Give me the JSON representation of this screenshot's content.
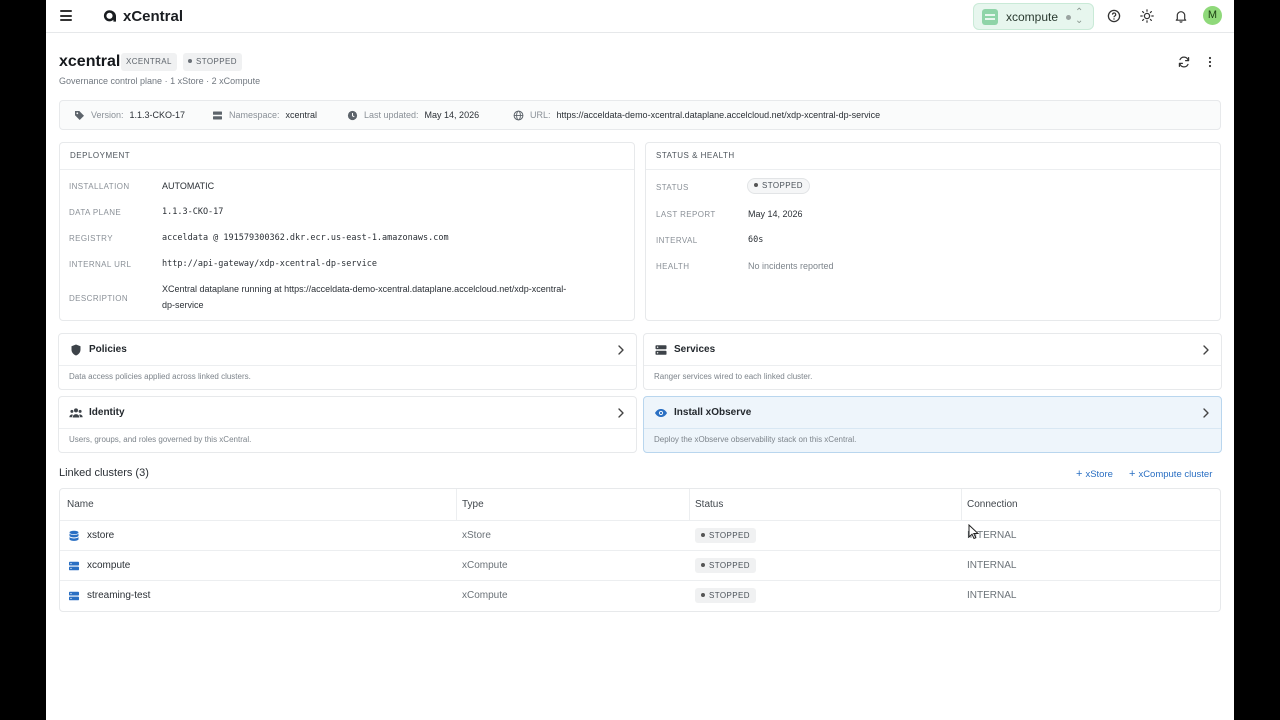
{
  "topbar": {
    "app_title": "xCentral",
    "cluster_selector": "xcompute",
    "avatar_initial": "M"
  },
  "page": {
    "title": "xcentral",
    "type_tag": "XCENTRAL",
    "status_tag": "STOPPED",
    "subtitle": "Governance control plane · 1 xStore · 2 xCompute"
  },
  "info": {
    "version_label": "Version:",
    "version": "1.1.3-CKO-17",
    "namespace_label": "Namespace:",
    "namespace": "xcentral",
    "updated_label": "Last updated:",
    "updated": "May 14, 2026",
    "url_label": "URL:",
    "url": "https://acceldata-demo-xcentral.dataplane.accelcloud.net/xdp-xcentral-dp-service"
  },
  "deployment": {
    "heading": "DEPLOYMENT",
    "installation_label": "INSTALLATION",
    "installation": "AUTOMATIC",
    "dataplane_label": "DATA PLANE",
    "dataplane": "1.1.3-CKO-17",
    "registry_label": "REGISTRY",
    "registry": "acceldata @ 191579300362.dkr.ecr.us-east-1.amazonaws.com",
    "internal_url_label": "INTERNAL URL",
    "internal_url": "http://api-gateway/xdp-xcentral-dp-service",
    "description_label": "DESCRIPTION",
    "description_line1": "XCentral dataplane running at https://acceldata-demo-xcentral.dataplane.accelcloud.net/xdp-xcentral-",
    "description_line2": "dp-service"
  },
  "health": {
    "heading": "STATUS & HEALTH",
    "status_label": "STATUS",
    "status": "STOPPED",
    "last_report_label": "LAST REPORT",
    "last_report": "May 14, 2026",
    "interval_label": "INTERVAL",
    "interval": "60s",
    "health_label": "HEALTH",
    "health": "No incidents reported"
  },
  "cards": {
    "policies": {
      "title": "Policies",
      "desc": "Data access policies applied across linked clusters."
    },
    "services": {
      "title": "Services",
      "desc": "Ranger services wired to each linked cluster."
    },
    "identity": {
      "title": "Identity",
      "desc": "Users, groups, and roles governed by this xCentral."
    },
    "xobserve": {
      "title": "Install xObserve",
      "desc": "Deploy the xObserve observability stack on this xCentral."
    }
  },
  "linked": {
    "title": "Linked clusters (3)",
    "add_xstore": "xStore",
    "add_xcompute": "xCompute cluster",
    "headers": {
      "name": "Name",
      "type": "Type",
      "status": "Status",
      "connection": "Connection"
    },
    "rows": [
      {
        "name": "xstore",
        "type": "xStore",
        "status": "STOPPED",
        "connection": "INTERNAL"
      },
      {
        "name": "xcompute",
        "type": "xCompute",
        "status": "STOPPED",
        "connection": "INTERNAL"
      },
      {
        "name": "streaming-test",
        "type": "xCompute",
        "status": "STOPPED",
        "connection": "INTERNAL"
      }
    ]
  },
  "colors": {
    "accent_blue": "#2a6fc3",
    "cluster_pill_bg": "#e7f6ee",
    "avatar_bg": "#8fd97a",
    "active_card_bg": "#eef5fb"
  },
  "icons": {
    "menu": "hamburger-icon",
    "help": "help-icon",
    "theme": "sun-icon",
    "notifications": "bell-icon",
    "refresh": "refresh-icon",
    "more": "more-vertical-icon"
  }
}
